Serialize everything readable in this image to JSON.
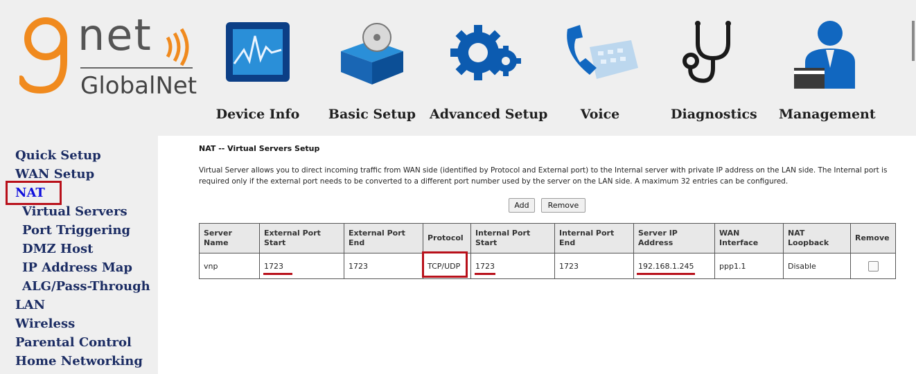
{
  "brand": {
    "logo_word": "net",
    "logo_sub": "GlobalNet",
    "accent": "#f08a1e",
    "alert_color": "#b8101a"
  },
  "top_nav": [
    {
      "label": "Device Info",
      "icon": "chart-monitor-icon"
    },
    {
      "label": "Basic Setup",
      "icon": "box-disc-icon"
    },
    {
      "label": "Advanced Setup",
      "icon": "gears-icon"
    },
    {
      "label": "Voice",
      "icon": "phone-keypad-icon"
    },
    {
      "label": "Diagnostics",
      "icon": "stethoscope-icon"
    },
    {
      "label": "Management",
      "icon": "user-admin-icon"
    }
  ],
  "sidebar": {
    "items": [
      {
        "label": "Quick Setup"
      },
      {
        "label": "WAN Setup"
      },
      {
        "label": "NAT"
      },
      {
        "label": "Virtual Servers"
      },
      {
        "label": "Port Triggering"
      },
      {
        "label": "DMZ Host"
      },
      {
        "label": "IP Address Map"
      },
      {
        "label": "ALG/Pass-Through"
      },
      {
        "label": "LAN"
      },
      {
        "label": "Wireless"
      },
      {
        "label": "Parental Control"
      },
      {
        "label": "Home Networking"
      }
    ]
  },
  "main": {
    "title": "NAT -- Virtual Servers Setup",
    "description": "Virtual Server allows you to direct incoming traffic from WAN side (identified by Protocol and External port) to the Internal server with private IP address on the LAN side. The Internal port is required only if the external port needs to be converted to a different port number used by the server on the LAN side. A maximum 32 entries can be configured.",
    "add_label": "Add",
    "remove_label": "Remove",
    "table": {
      "headers": [
        "Server Name",
        "External Port Start",
        "External Port End",
        "Protocol",
        "Internal Port Start",
        "Internal Port End",
        "Server IP Address",
        "WAN Interface",
        "NAT Loopback",
        "Remove"
      ],
      "rows": [
        [
          "vnp",
          "1723",
          "1723",
          "TCP/UDP",
          "1723",
          "1723",
          "192.168.1.245",
          "ppp1.1",
          "Disable",
          ""
        ]
      ]
    }
  }
}
